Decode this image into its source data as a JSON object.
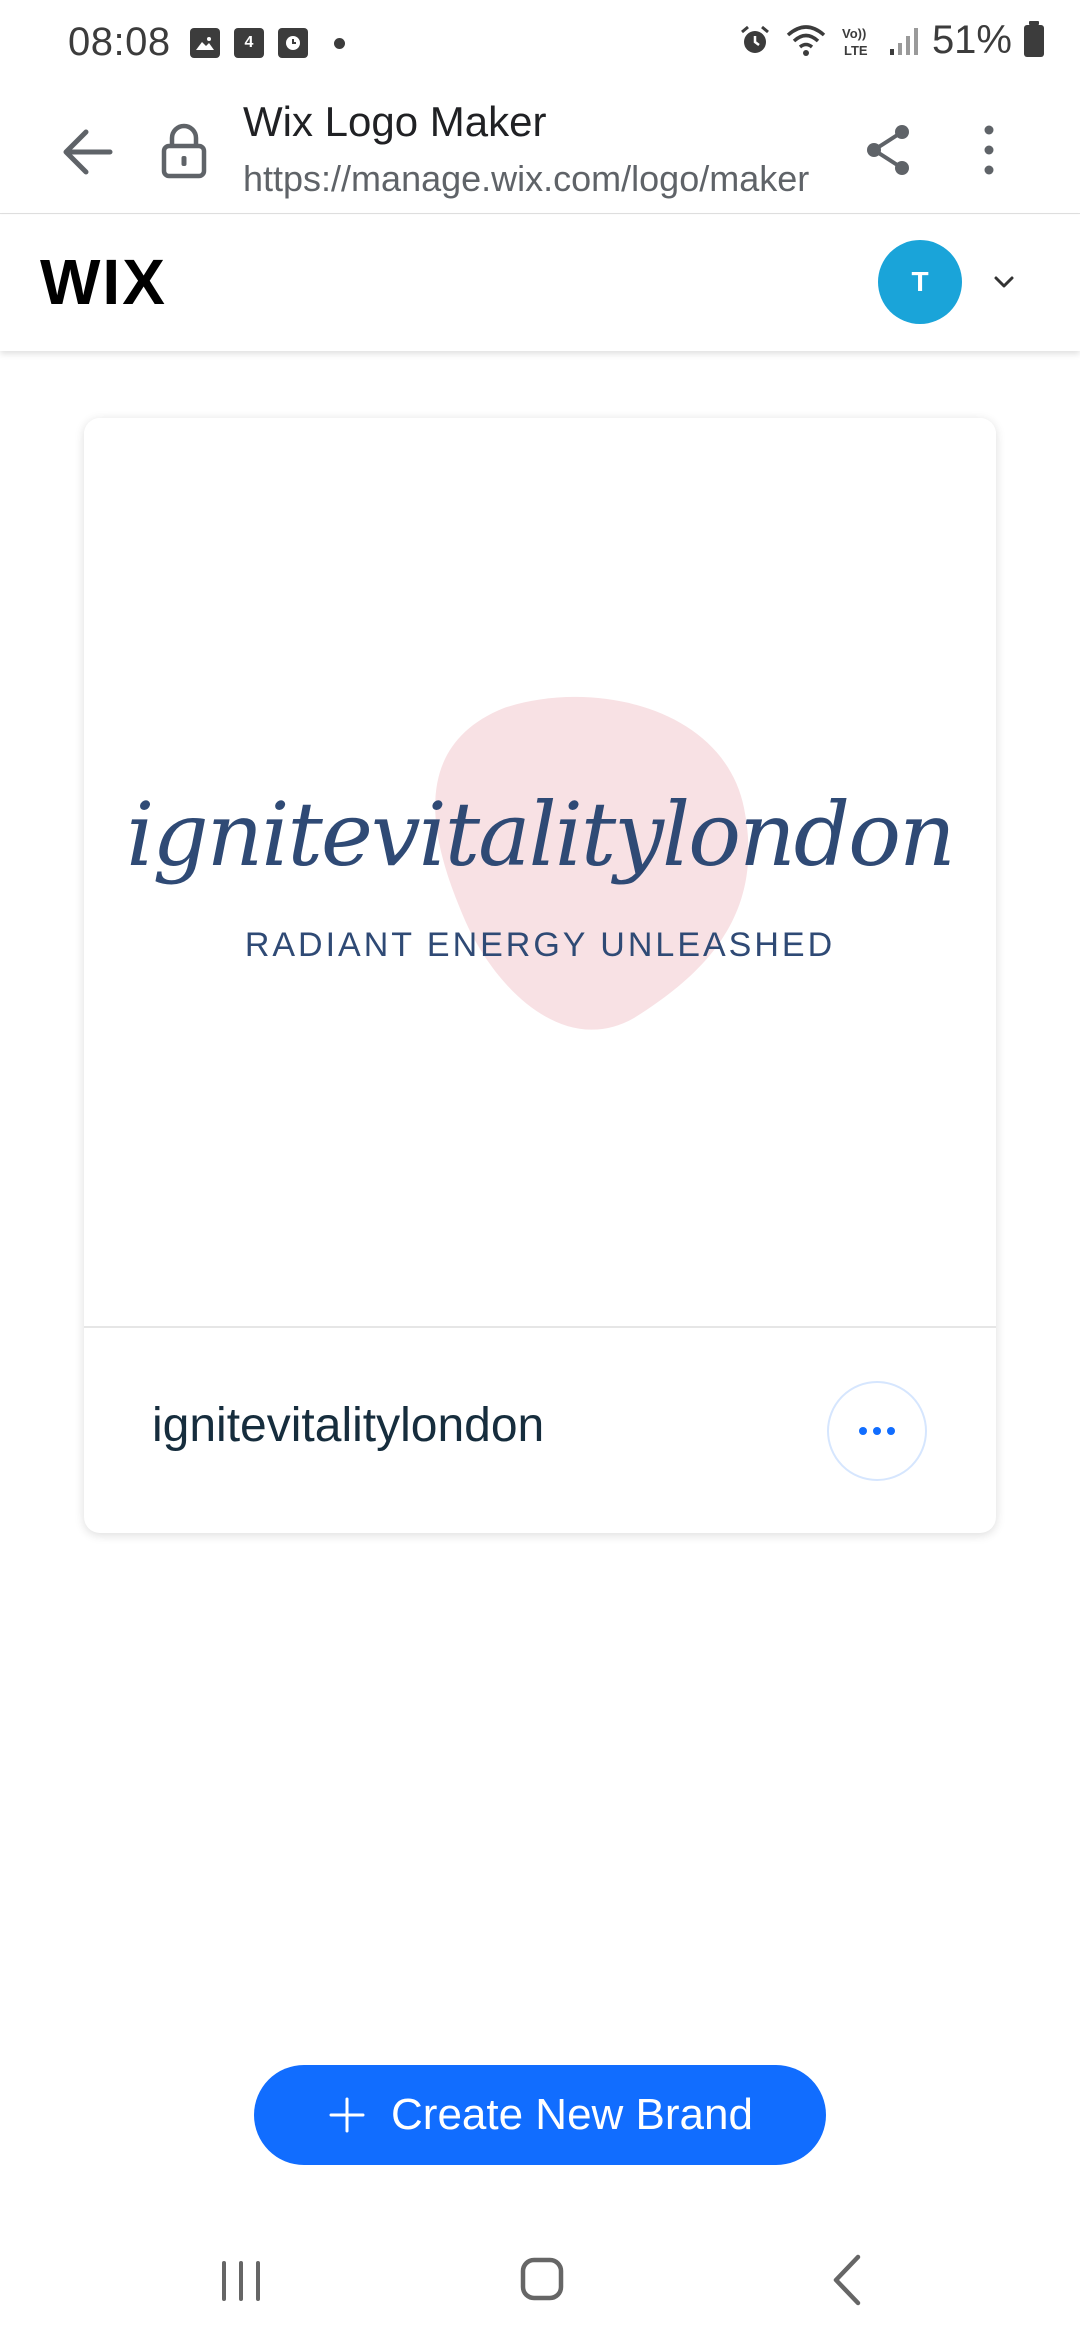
{
  "status_bar": {
    "time": "08:08",
    "notification_badge": "4",
    "battery_text": "51%",
    "icons": [
      "image-icon",
      "calendar-icon",
      "clock-app-icon",
      "dot-icon",
      "alarm-icon",
      "wifi-icon",
      "volte-icon",
      "signal-icon",
      "battery-icon"
    ]
  },
  "browser": {
    "page_title": "Wix Logo Maker",
    "url": "https://manage.wix.com/logo/maker",
    "icons": [
      "back-arrow-icon",
      "lock-icon",
      "share-icon",
      "more-vert-icon"
    ]
  },
  "wix_header": {
    "logo_text": "WIX",
    "avatar_initial": "T",
    "avatar_color": "#1aa4d9"
  },
  "brand_card": {
    "logo_name": "ignitevitalitylondon",
    "logo_tagline": "RADIANT ENERGY UNLEASHED",
    "brand_name": "ignitevitalitylondon",
    "logo_text_color": "#2f4a75",
    "blob_color": "#f8e1e4"
  },
  "actions": {
    "create_label": "Create New Brand",
    "accent_color": "#116dff"
  },
  "nav_bar": {
    "icons": [
      "recents-icon",
      "home-icon",
      "nav-back-icon"
    ]
  }
}
